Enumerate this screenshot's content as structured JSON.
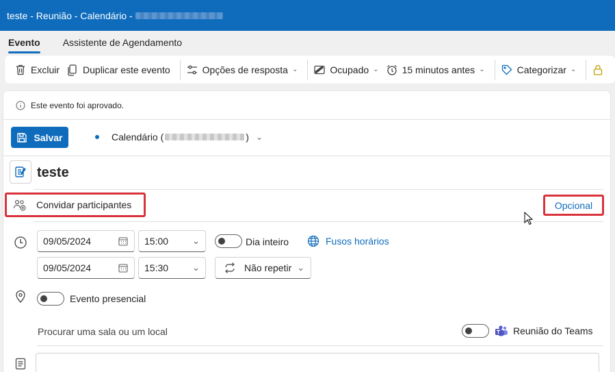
{
  "titlebar": {
    "title": "teste - Reunião - Calendário -"
  },
  "tabs": [
    {
      "label": "Evento",
      "active": true
    },
    {
      "label": "Assistente de Agendamento",
      "active": false
    }
  ],
  "toolbar": {
    "delete": "Excluir",
    "duplicate": "Duplicar este evento",
    "response_options": "Opções de resposta",
    "show_as": "Ocupado",
    "reminder": "15 minutos antes",
    "categorize": "Categorizar"
  },
  "notice": "Este evento foi aprovado.",
  "save_label": "Salvar",
  "calendar": {
    "prefix": "Calendário (",
    "suffix": ")"
  },
  "event": {
    "title": "teste",
    "invite_placeholder": "Convidar participantes",
    "optional_label": "Opcional",
    "start_date": "09/05/2024",
    "start_time": "15:00",
    "end_date": "09/05/2024",
    "end_time": "15:30",
    "all_day_label": "Dia inteiro",
    "time_zones_label": "Fusos horários",
    "repeat_label": "Não repetir",
    "in_person_label": "Evento presencial",
    "location_placeholder": "Procurar uma sala ou um local",
    "teams_label": "Reunião do Teams"
  },
  "colors": {
    "accent": "#0f6cbd",
    "highlight": "#d9323b"
  }
}
